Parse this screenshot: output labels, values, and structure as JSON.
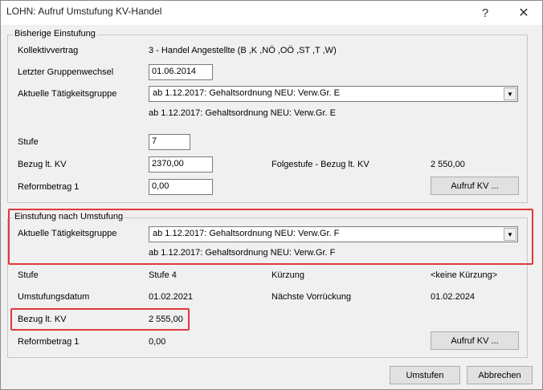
{
  "window": {
    "title": "LOHN: Aufruf Umstufung KV-Handel",
    "help_glyph": "?",
    "close_glyph": "✕"
  },
  "bisherige": {
    "legend": "Bisherige Einstufung",
    "kollektivvertrag_label": "Kollektivvertrag",
    "kollektivvertrag_value": "3 - Handel Angestellte (B ,K ,NÖ ,OÖ ,ST ,T ,W)",
    "gruppenwechsel_label": "Letzter Gruppenwechsel",
    "gruppenwechsel_value": "01.06.2014",
    "taetigkeit_label": "Aktuelle Tätigkeitsgruppe",
    "taetigkeit_selected": "ab 1.12.2017: Gehaltsordnung NEU: Verw.Gr. E",
    "taetigkeit_text": "ab 1.12.2017: Gehaltsordnung NEU: Verw.Gr. E",
    "stufe_label": "Stufe",
    "stufe_value": "7",
    "bezug_label": "Bezug lt. KV",
    "bezug_value": "2370,00",
    "folgestufe_label": "Folgestufe - Bezug lt. KV",
    "folgestufe_value": "2 550,00",
    "reform_label": "Reformbetrag 1",
    "reform_value": "0,00",
    "aufruf_button": "Aufruf KV ..."
  },
  "nach": {
    "legend": "Einstufung nach Umstufung",
    "taetigkeit_label": "Aktuelle Tätigkeitsgruppe",
    "taetigkeit_selected": "ab 1.12.2017: Gehaltsordnung NEU: Verw.Gr. F",
    "taetigkeit_text": "ab 1.12.2017: Gehaltsordnung NEU: Verw.Gr. F",
    "stufe_label": "Stufe",
    "stufe_value": "Stufe 4",
    "kuerzung_label": "Kürzung",
    "kuerzung_value": "<keine Kürzung>",
    "datum_label": "Umstufungsdatum",
    "datum_value": "01.02.2021",
    "vorrueckung_label": "Nächste Vorrückung",
    "vorrueckung_value": "01.02.2024",
    "bezug_label": "Bezug lt. KV",
    "bezug_value": "2 555,00",
    "reform_label": "Reformbetrag 1",
    "reform_value": "0,00",
    "aufruf_button": "Aufruf KV ..."
  },
  "footer": {
    "umstufen_button": "Umstufen",
    "abbrechen_button": "Abbrechen"
  },
  "colors": {
    "highlight": "#e0393c"
  }
}
